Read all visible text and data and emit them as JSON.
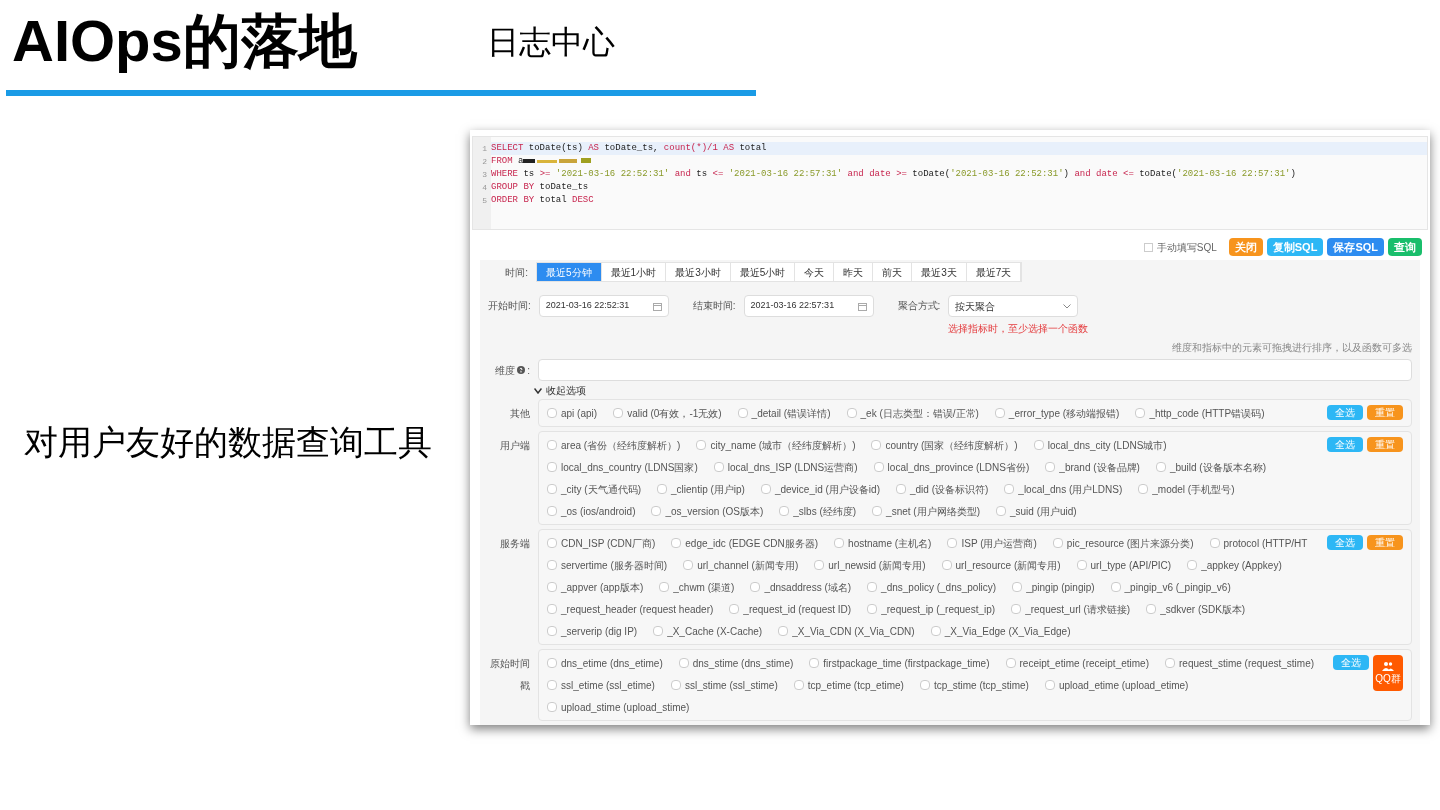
{
  "slide": {
    "title": "AIOps的落地",
    "subtitle": "日志中心",
    "caption": "对用户友好的数据查询工具"
  },
  "editor": {
    "lines": [
      {
        "number": "1",
        "tokens": [
          {
            "kind": "kw",
            "text": "SELECT"
          },
          {
            "kind": "plain",
            "text": " toDate(ts) "
          },
          {
            "kind": "kw",
            "text": "AS"
          },
          {
            "kind": "plain",
            "text": " toDate_ts, "
          },
          {
            "kind": "kw",
            "text": "count(*)/1"
          },
          {
            "kind": "kw",
            "text": " AS"
          },
          {
            "kind": "plain",
            "text": " total"
          }
        ]
      },
      {
        "number": "2",
        "redacted": true,
        "tokens": [
          {
            "kind": "kw",
            "text": "FROM"
          },
          {
            "kind": "plain",
            "text": " a"
          }
        ]
      },
      {
        "number": "3",
        "tokens": [
          {
            "kind": "kw",
            "text": "WHERE"
          },
          {
            "kind": "plain",
            "text": " ts "
          },
          {
            "kind": "kw",
            "text": ">="
          },
          {
            "kind": "str",
            "text": " '2021-03-16 22:52:31'"
          },
          {
            "kind": "kw",
            "text": " and"
          },
          {
            "kind": "plain",
            "text": " ts "
          },
          {
            "kind": "kw",
            "text": "<="
          },
          {
            "kind": "str",
            "text": " '2021-03-16 22:57:31'"
          },
          {
            "kind": "kw",
            "text": " and date >="
          },
          {
            "kind": "plain",
            "text": " toDate("
          },
          {
            "kind": "str",
            "text": "'2021-03-16 22:52:31'"
          },
          {
            "kind": "plain",
            "text": ") "
          },
          {
            "kind": "kw",
            "text": "and date <="
          },
          {
            "kind": "plain",
            "text": " toDate("
          },
          {
            "kind": "str",
            "text": "'2021-03-16 22:57:31'"
          },
          {
            "kind": "plain",
            "text": ")"
          }
        ]
      },
      {
        "number": "4",
        "tokens": [
          {
            "kind": "kw",
            "text": "GROUP BY"
          },
          {
            "kind": "plain",
            "text": " toDate_ts"
          }
        ]
      },
      {
        "number": "5",
        "tokens": [
          {
            "kind": "kw",
            "text": "ORDER BY"
          },
          {
            "kind": "plain",
            "text": " total "
          },
          {
            "kind": "kw",
            "text": "DESC"
          }
        ]
      }
    ]
  },
  "actions": {
    "manual_sql": {
      "label": "手动填写SQL",
      "checked": false
    },
    "buttons": [
      {
        "label": "关闭",
        "color": "#f7941d"
      },
      {
        "label": "复制SQL",
        "color": "#2db7f5"
      },
      {
        "label": "保存SQL",
        "color": "#2d8cf0"
      },
      {
        "label": "查询",
        "color": "#19be6b"
      }
    ]
  },
  "time": {
    "label": "时间:",
    "tabs": [
      {
        "label": "最近5分钟",
        "selected": true
      },
      {
        "label": "最近1小时",
        "selected": false
      },
      {
        "label": "最近3小时",
        "selected": false
      },
      {
        "label": "最近5小时",
        "selected": false
      },
      {
        "label": "今天",
        "selected": false
      },
      {
        "label": "昨天",
        "selected": false
      },
      {
        "label": "前天",
        "selected": false
      },
      {
        "label": "最近3天",
        "selected": false
      },
      {
        "label": "最近7天",
        "selected": false
      }
    ]
  },
  "start": {
    "label": "开始时间:",
    "value": "2021-03-16 22:52:31"
  },
  "end": {
    "label": "结束时间:",
    "value": "2021-03-16 22:57:31"
  },
  "aggregate": {
    "label": "聚合方式:",
    "value": "按天聚合",
    "error": "选择指标时，至少选择一个函数"
  },
  "hint": "维度和指标中的元素可拖拽进行排序，以及函数可多选",
  "dimension": {
    "label": "维度",
    "suffix": ":"
  },
  "collapse": "收起选项",
  "groups": [
    {
      "label": "其他",
      "buttons": [
        "全选",
        "重置"
      ],
      "items": [
        {
          "label": "api (api)",
          "checked": false
        },
        {
          "label": "valid (0有效，-1无效)",
          "checked": false
        },
        {
          "label": "_detail (错误详情)",
          "checked": false
        },
        {
          "label": "_ek (日志类型：错误/正常)",
          "checked": false
        },
        {
          "label": "_error_type (移动端报错)",
          "checked": false
        },
        {
          "label": "_http_code (HTTP错误码)",
          "checked": false
        }
      ]
    },
    {
      "label": "用户端",
      "buttons": [
        "全选",
        "重置"
      ],
      "items": [
        {
          "label": "area (省份（经纬度解析）)",
          "checked": false
        },
        {
          "label": "city_name (城市（经纬度解析）)",
          "checked": false
        },
        {
          "label": "country (国家（经纬度解析）)",
          "checked": false
        },
        {
          "label": "local_dns_city (LDNS城市)",
          "checked": false
        },
        {
          "label": "local_dns_country (LDNS国家)",
          "checked": false
        },
        {
          "label": "local_dns_ISP (LDNS运营商)",
          "checked": false
        },
        {
          "label": "local_dns_province (LDNS省份)",
          "checked": false
        },
        {
          "label": "_brand (设备品牌)",
          "checked": false
        },
        {
          "label": "_build (设备版本名称)",
          "checked": false
        },
        {
          "label": "_city (天气通代码)",
          "checked": false
        },
        {
          "label": "_clientip (用户ip)",
          "checked": false
        },
        {
          "label": "_device_id (用户设备id)",
          "checked": false
        },
        {
          "label": "_did (设备标识符)",
          "checked": false
        },
        {
          "label": "_local_dns (用户LDNS)",
          "checked": false
        },
        {
          "label": "_model (手机型号)",
          "checked": false
        },
        {
          "label": "_os (ios/android)",
          "checked": false
        },
        {
          "label": "_os_version (OS版本)",
          "checked": false
        },
        {
          "label": "_slbs (经纬度)",
          "checked": false
        },
        {
          "label": "_snet (用户网络类型)",
          "checked": false
        },
        {
          "label": "_suid (用户uid)",
          "checked": false
        }
      ]
    },
    {
      "label": "服务端",
      "buttons": [
        "全选",
        "重置"
      ],
      "items": [
        {
          "label": "CDN_ISP (CDN厂商)",
          "checked": false
        },
        {
          "label": "edge_idc (EDGE CDN服务器)",
          "checked": false
        },
        {
          "label": "hostname (主机名)",
          "checked": false
        },
        {
          "label": "ISP (用户运营商)",
          "checked": false
        },
        {
          "label": "pic_resource (图片来源分类)",
          "checked": false
        },
        {
          "label": "protocol (HTTP/HT",
          "checked": false
        },
        {
          "label": "servertime (服务器时间)",
          "checked": false
        },
        {
          "label": "url_channel (新闻专用)",
          "checked": false
        },
        {
          "label": "url_newsid (新闻专用)",
          "checked": false
        },
        {
          "label": "url_resource (新闻专用)",
          "checked": false
        },
        {
          "label": "url_type (API/PIC)",
          "checked": false
        },
        {
          "label": "_appkey (Appkey)",
          "checked": false
        },
        {
          "label": "_appver (app版本)",
          "checked": false
        },
        {
          "label": "_chwm (渠道)",
          "checked": false
        },
        {
          "label": "_dnsaddress (域名)",
          "checked": false
        },
        {
          "label": "_dns_policy (_dns_policy)",
          "checked": false
        },
        {
          "label": "_pingip (pingip)",
          "checked": false
        },
        {
          "label": "_pingip_v6 (_pingip_v6)",
          "checked": false
        },
        {
          "label": "_request_header (request header)",
          "checked": false
        },
        {
          "label": "_request_id (request ID)",
          "checked": false
        },
        {
          "label": "_request_ip (_request_ip)",
          "checked": false
        },
        {
          "label": "_request_url (请求链接)",
          "checked": false
        },
        {
          "label": "_sdkver (SDK版本)",
          "checked": false
        },
        {
          "label": "_serverip (dig IP)",
          "checked": false
        },
        {
          "label": "_X_Cache (X-Cache)",
          "checked": false
        },
        {
          "label": "_X_Via_CDN (X_Via_CDN)",
          "checked": false
        },
        {
          "label": "_X_Via_Edge (X_Via_Edge)",
          "checked": false
        }
      ]
    },
    {
      "label": "原始时间戳",
      "buttons": [
        "全选"
      ],
      "items": [
        {
          "label": "dns_etime (dns_etime)",
          "checked": false
        },
        {
          "label": "dns_stime (dns_stime)",
          "checked": false
        },
        {
          "label": "firstpackage_time (firstpackage_time)",
          "checked": false
        },
        {
          "label": "receipt_etime (receipt_etime)",
          "checked": false
        },
        {
          "label": "request_stime (request_stime)",
          "checked": false
        },
        {
          "label": "ssl_etime (ssl_etime)",
          "checked": false
        },
        {
          "label": "ssl_stime (ssl_stime)",
          "checked": false
        },
        {
          "label": "tcp_etime (tcp_etime)",
          "checked": false
        },
        {
          "label": "tcp_stime (tcp_stime)",
          "checked": false
        },
        {
          "label": "upload_etime (upload_etime)",
          "checked": false
        },
        {
          "label": "upload_stime (upload_stime)",
          "checked": false
        }
      ]
    }
  ],
  "float_badge": {
    "label": "QQ群"
  }
}
